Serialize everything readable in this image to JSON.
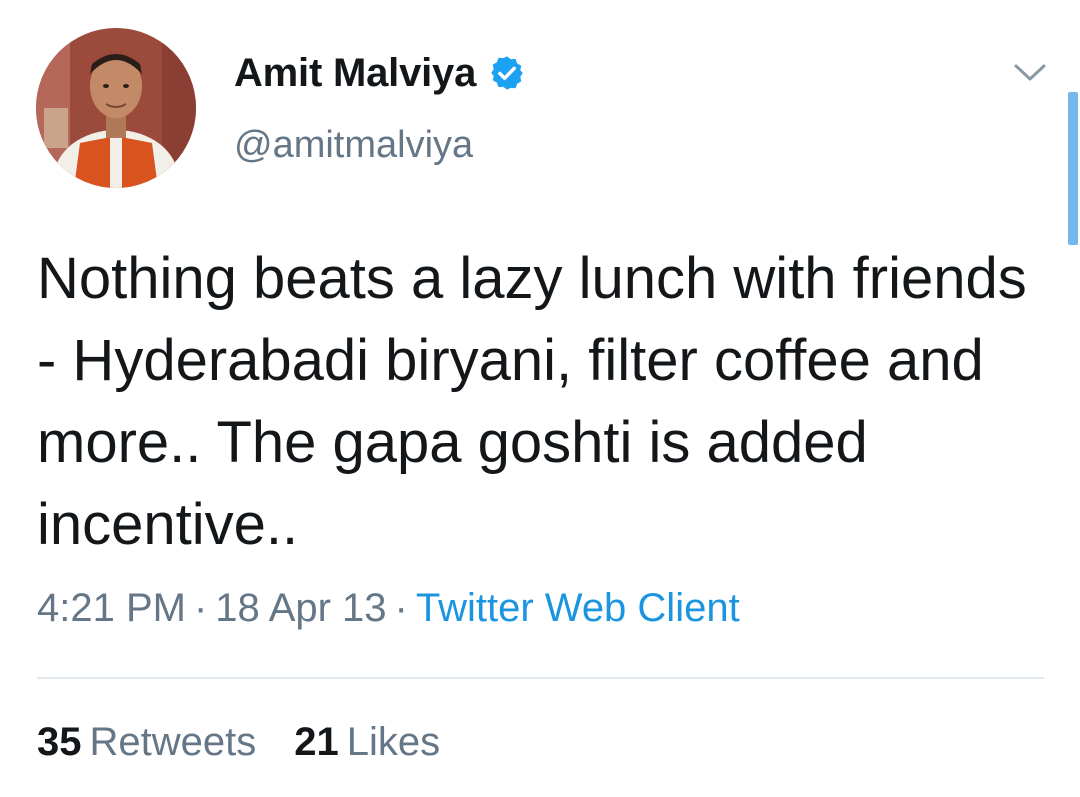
{
  "author": {
    "display_name": "Amit Malviya",
    "handle": "@amitmalviya",
    "verified": true,
    "verified_icon": "verified-badge-icon",
    "avatar": "profile-avatar"
  },
  "menu": {
    "icon": "chevron-down-icon"
  },
  "tweet": {
    "text": "Nothing beats a lazy lunch with friends - Hyderabadi biryani, filter coffee and more.. The gapa goshti is added incentive..",
    "time": "4:21 PM",
    "separator1": "·",
    "date": "18 Apr 13",
    "separator2": "·",
    "client": "Twitter Web Client"
  },
  "stats": {
    "retweets_count": "35",
    "retweets_label": "Retweets",
    "likes_count": "21",
    "likes_label": "Likes"
  },
  "colors": {
    "text_primary": "#14171a",
    "text_secondary": "#657786",
    "link": "#1b95e0",
    "verified": "#1da1f2",
    "divider": "#e1e8ed"
  }
}
